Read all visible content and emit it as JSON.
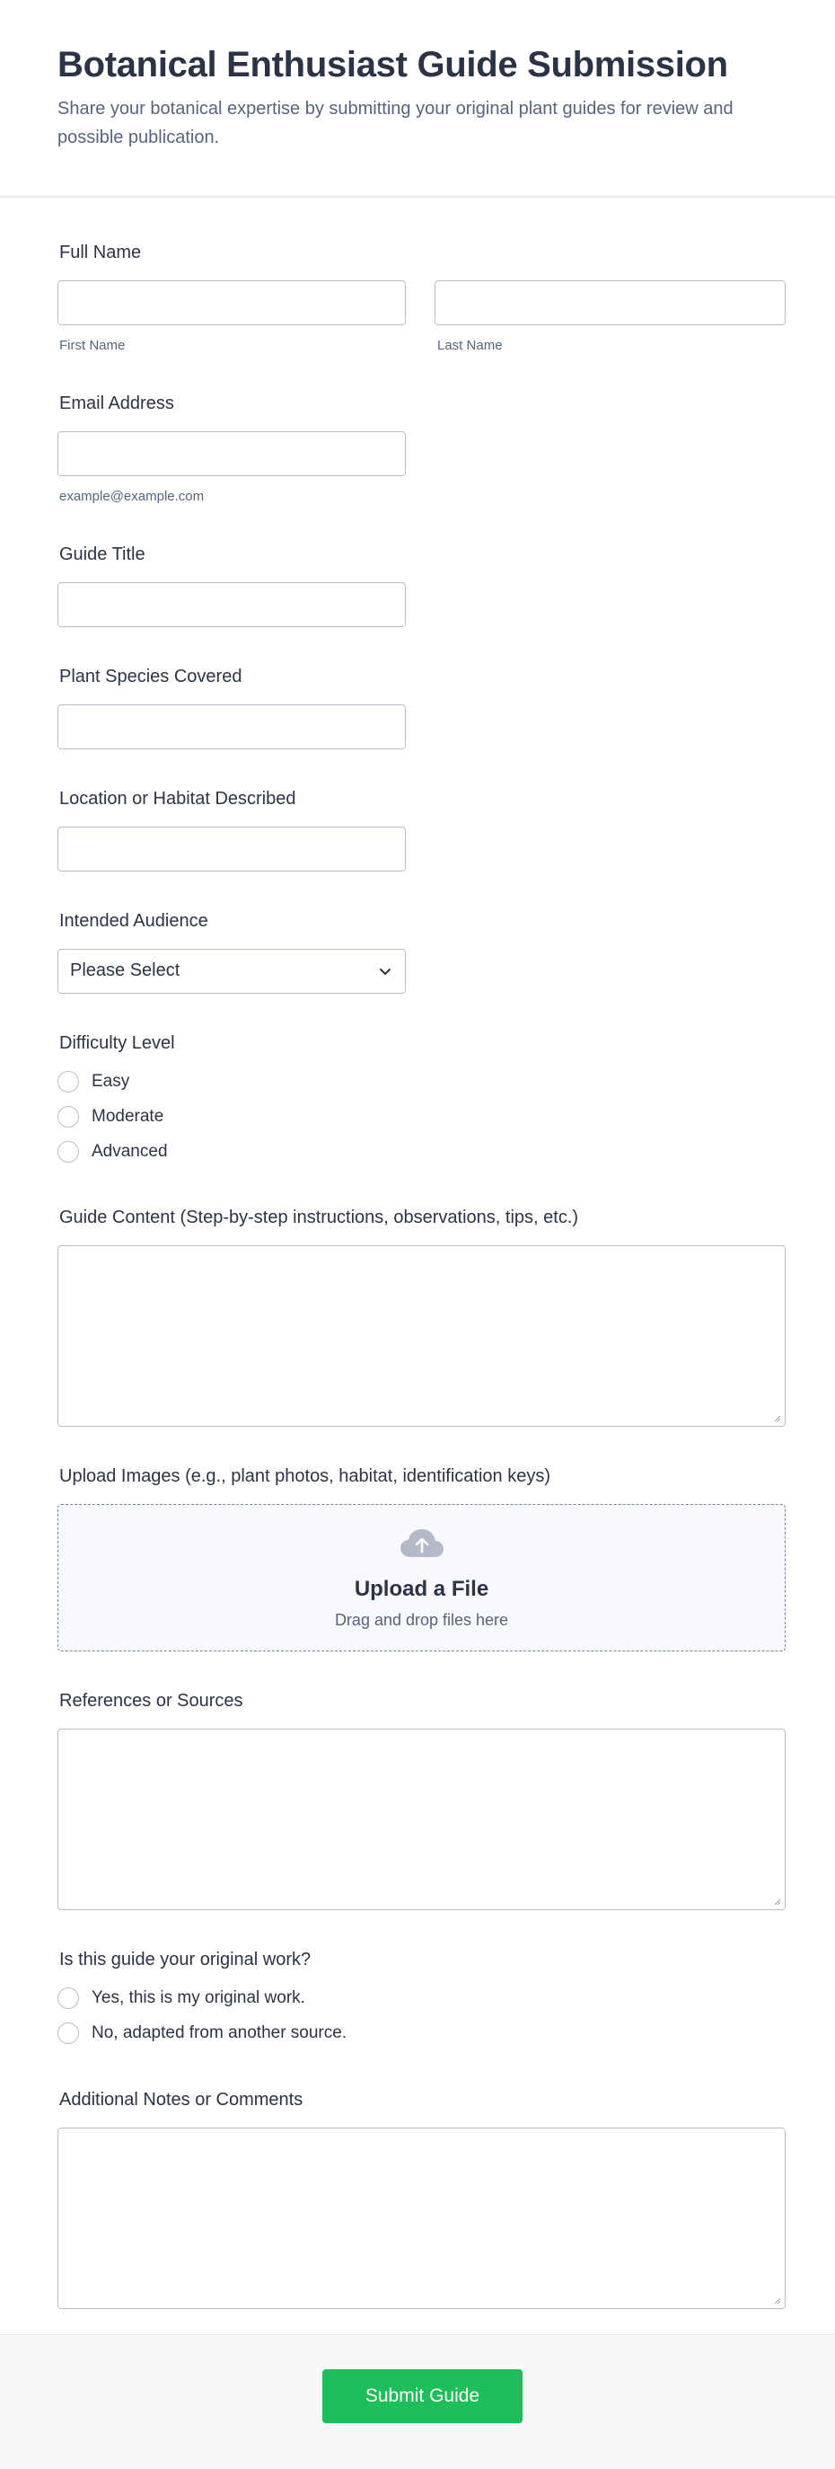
{
  "header": {
    "title": "Botanical Enthusiast Guide Submission",
    "subtitle": "Share your botanical expertise by submitting your original plant guides for review and possible publication."
  },
  "fields": {
    "full_name": {
      "label": "Full Name",
      "first_sublabel": "First Name",
      "last_sublabel": "Last Name",
      "first_value": "",
      "last_value": ""
    },
    "email": {
      "label": "Email Address",
      "sublabel": "example@example.com",
      "value": ""
    },
    "guide_title": {
      "label": "Guide Title",
      "value": ""
    },
    "species": {
      "label": "Plant Species Covered",
      "value": ""
    },
    "location": {
      "label": "Location or Habitat Described",
      "value": ""
    },
    "audience": {
      "label": "Intended Audience",
      "selected": "Please Select"
    },
    "difficulty": {
      "label": "Difficulty Level",
      "options": [
        "Easy",
        "Moderate",
        "Advanced"
      ]
    },
    "content": {
      "label": "Guide Content (Step-by-step instructions, observations, tips, etc.)",
      "value": ""
    },
    "upload": {
      "label": "Upload Images (e.g., plant photos, habitat, identification keys)",
      "title": "Upload a File",
      "hint": "Drag and drop files here",
      "icon": "cloud-upload-icon"
    },
    "references": {
      "label": "References or Sources",
      "value": ""
    },
    "original": {
      "label": "Is this guide your original work?",
      "options": [
        "Yes, this is my original work.",
        "No, adapted from another source."
      ]
    },
    "notes": {
      "label": "Additional Notes or Comments",
      "value": ""
    }
  },
  "footer": {
    "submit_label": "Submit Guide"
  },
  "colors": {
    "accent": "#1ebe5a",
    "text": "#2c3345",
    "muted": "#57647e",
    "border": "#b8bdc9",
    "upload_bg": "#f8f9fd"
  }
}
